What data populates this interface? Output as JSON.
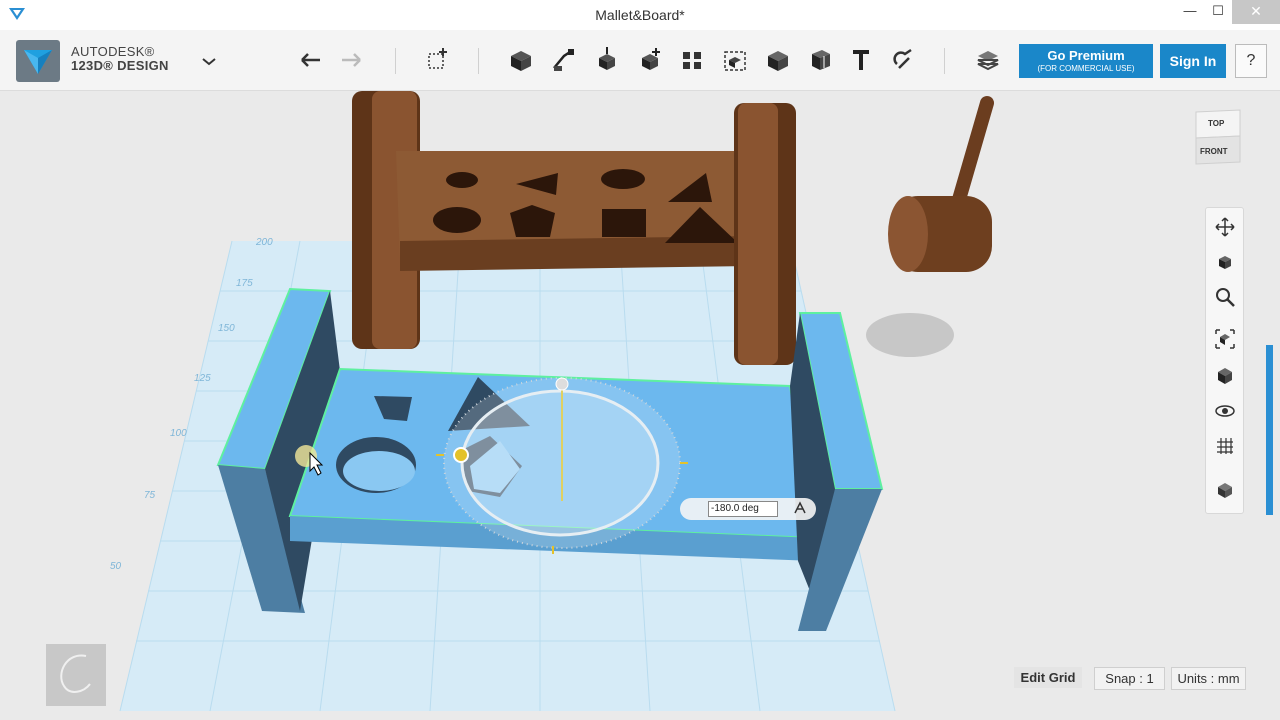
{
  "window": {
    "title": "Mallet&Board*",
    "minimize_glyph": "—",
    "maximize_glyph": "☐",
    "close_glyph": "✕"
  },
  "toolbar": {
    "brand_line1": "AUTODESK®",
    "brand_line2": "123D® DESIGN",
    "tools": [
      "undo-icon",
      "redo-icon",
      "transform-icon",
      "primitives-icon",
      "sketch-icon",
      "construct-icon",
      "modify-icon",
      "pattern-icon",
      "grouping-icon",
      "combine-icon",
      "measure-icon",
      "text-icon",
      "snap-icon",
      "material-icon"
    ],
    "premium_label": "Go Premium",
    "premium_sub": "(FOR COMMERCIAL USE)",
    "signin_label": "Sign In",
    "help_label": "?"
  },
  "viewcube": {
    "top_label": "TOP",
    "front_label": "FRONT"
  },
  "navbar": {
    "items": [
      "pan-icon",
      "orbit-icon",
      "zoom-icon",
      "fit-icon",
      "view-icon",
      "visibility-icon",
      "grid-view-icon",
      "material-view-icon"
    ]
  },
  "grid_labels": [
    "200",
    "175",
    "150",
    "125",
    "100",
    "75",
    "50"
  ],
  "rotate": {
    "value": "-180.0 deg"
  },
  "bottom": {
    "edit_grid": "Edit Grid",
    "snap": "Snap : 1",
    "units": "Units : mm"
  },
  "colors": {
    "accent": "#1a87c9",
    "selected_fill": "#6cb8ee",
    "wood": "#7a4a2a",
    "grid": "#b9dcef"
  }
}
